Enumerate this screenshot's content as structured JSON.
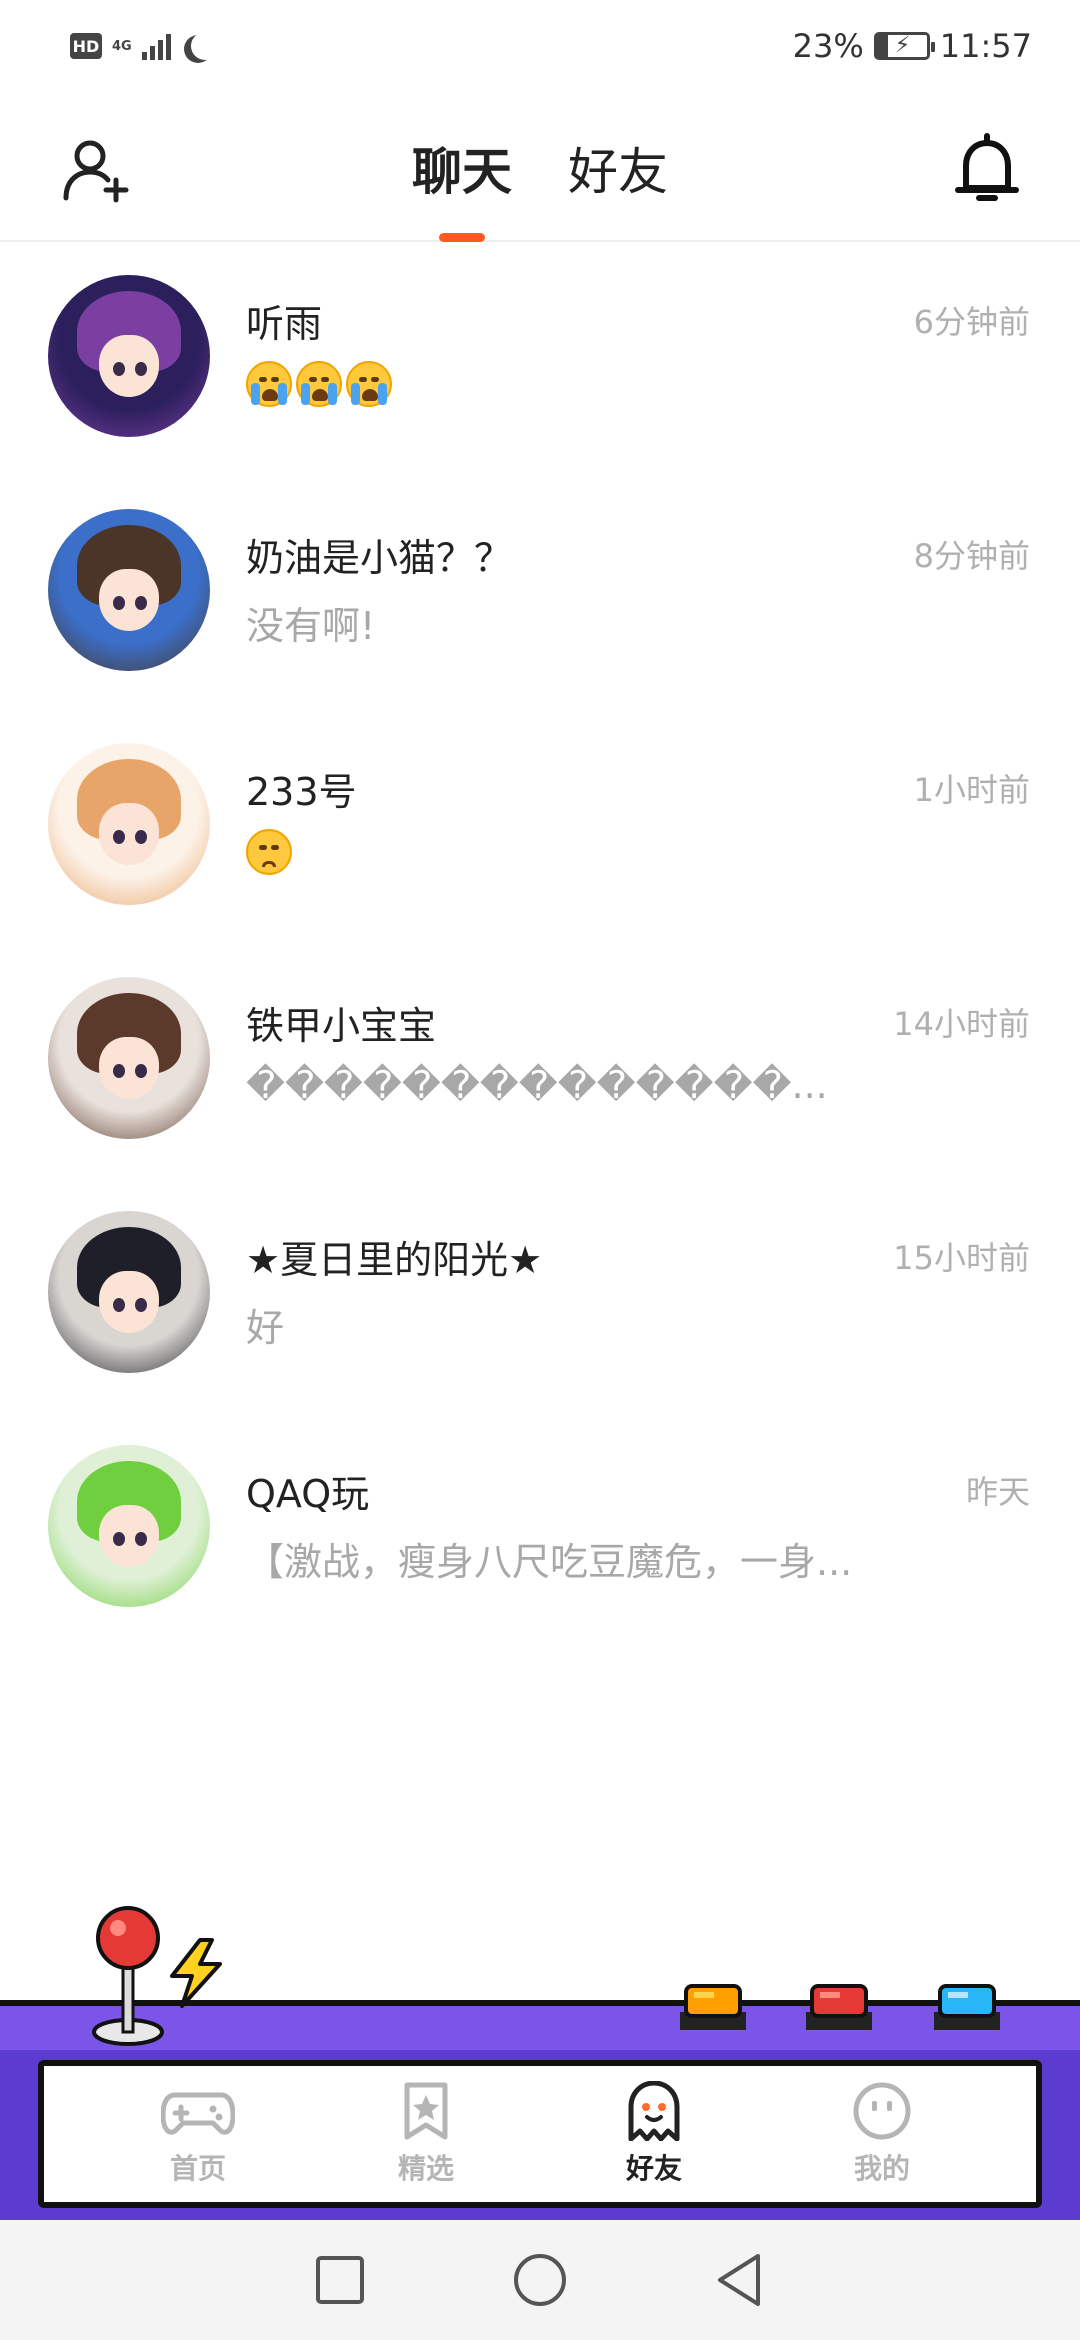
{
  "status_bar": {
    "hd": "HD",
    "network": "4G",
    "battery_text": "23%",
    "battery_level": 0.23,
    "time": "11:57"
  },
  "header": {
    "tabs": [
      {
        "label": "聊天",
        "active": true
      },
      {
        "label": "好友",
        "active": false
      }
    ]
  },
  "chats": [
    {
      "name": "听雨",
      "time": "6分钟前",
      "message": "",
      "emojis": [
        "crying",
        "crying",
        "crying"
      ],
      "avatar_colors": [
        "#2b1f5c",
        "#7a3fa0"
      ]
    },
    {
      "name": "奶油是小猫？？",
      "time": "8分钟前",
      "message": "没有啊!",
      "emojis": [],
      "avatar_colors": [
        "#3b6fc9",
        "#4a3526"
      ]
    },
    {
      "name": "233号",
      "time": "1小时前",
      "message": "",
      "emojis": [
        "sad"
      ],
      "avatar_colors": [
        "#fdf2e8",
        "#e8a56a"
      ]
    },
    {
      "name": "铁甲小宝宝",
      "time": "14小时前",
      "message": "��������������...",
      "emojis": [],
      "avatar_colors": [
        "#e9e2dc",
        "#5b3a2c"
      ]
    },
    {
      "name": "★夏日里的阳光★",
      "time": "15小时前",
      "message": "好",
      "emojis": [],
      "avatar_colors": [
        "#d9d6d2",
        "#1f1f2a"
      ]
    },
    {
      "name": "QAQ玩",
      "time": "昨天",
      "message": "【激战，瘦身八尺吃豆魔危，一身...",
      "emojis": [],
      "avatar_colors": [
        "#dff0d6",
        "#6fcf3f"
      ]
    }
  ],
  "bottom_nav": [
    {
      "label": "首页",
      "icon": "gamepad-icon",
      "active": false
    },
    {
      "label": "精选",
      "icon": "star-bookmark-icon",
      "active": false
    },
    {
      "label": "好友",
      "icon": "ghost-icon",
      "active": true
    },
    {
      "label": "我的",
      "icon": "smiley-icon",
      "active": false
    }
  ],
  "colors": {
    "accent": "#ff5a1f",
    "console_purple": "#5b3bd0",
    "console_light": "#7b54e8"
  }
}
